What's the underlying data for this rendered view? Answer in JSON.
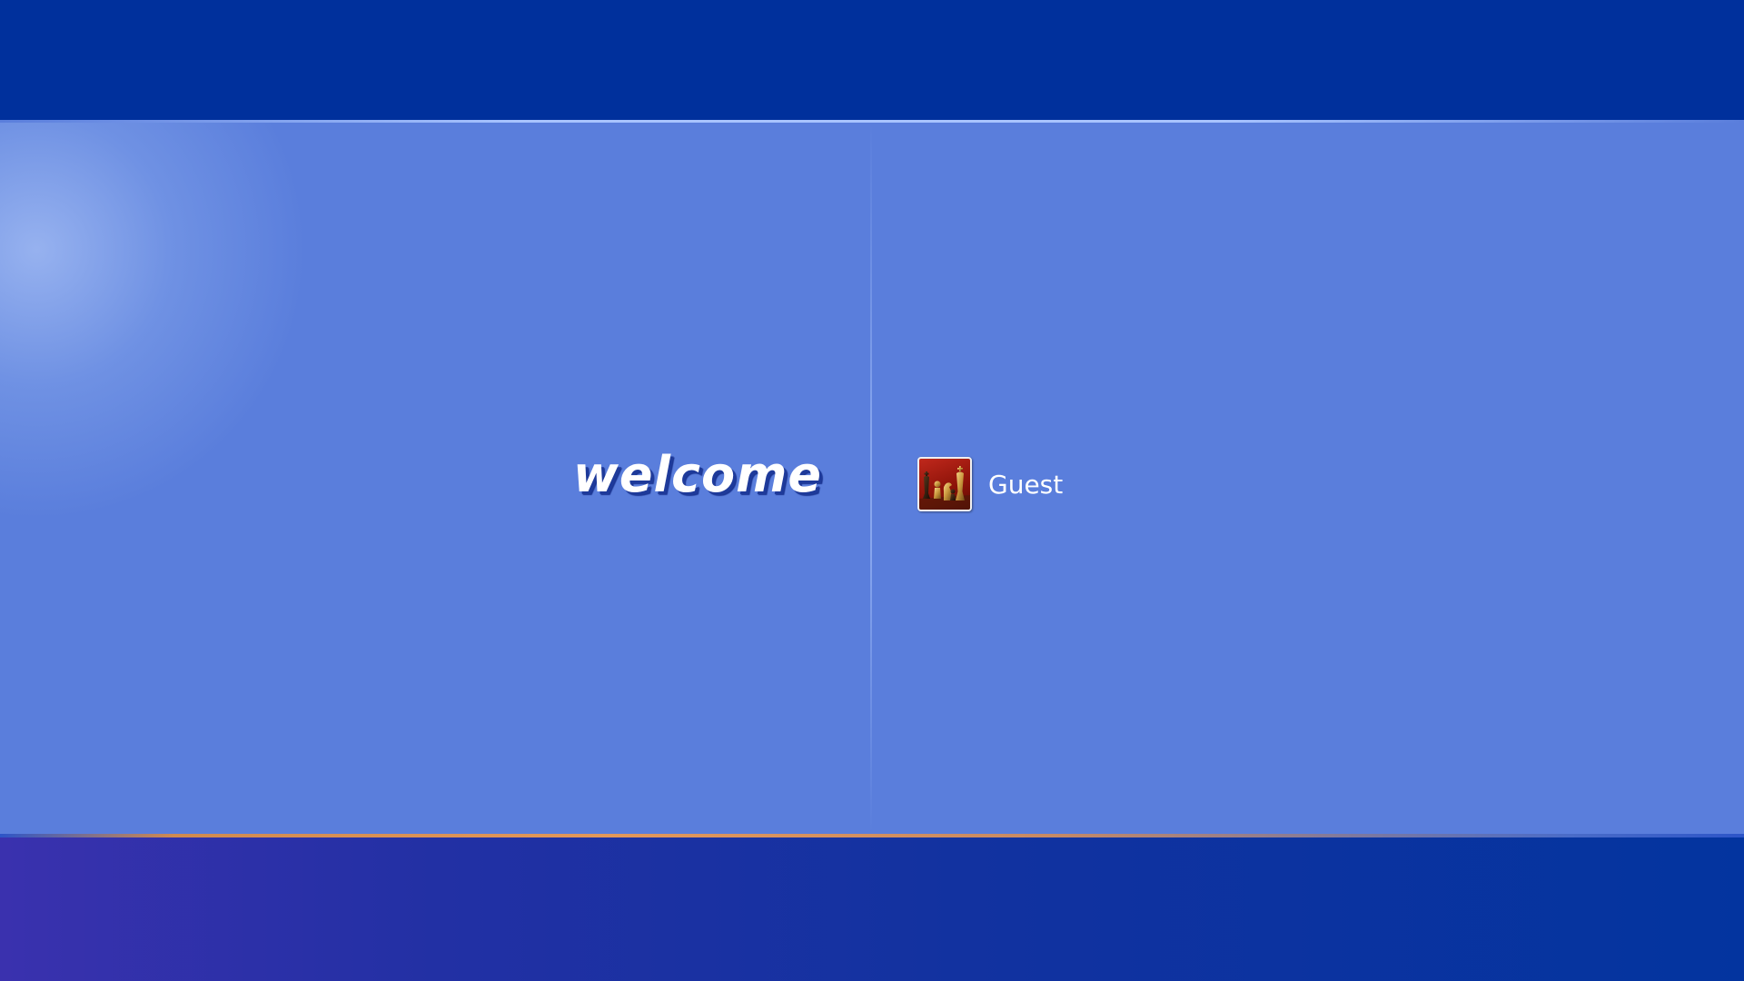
{
  "welcome_screen": {
    "welcome_text": "welcome",
    "users": [
      {
        "name": "Guest",
        "avatar_icon": "chess-pieces-icon"
      }
    ]
  },
  "colors": {
    "top_bar": "#00309C",
    "main_panel": "#5A7EDC",
    "bottom_bar_start": "#3A31AE",
    "bottom_bar_end": "#03349F",
    "accent_rule": "#E3985A"
  }
}
